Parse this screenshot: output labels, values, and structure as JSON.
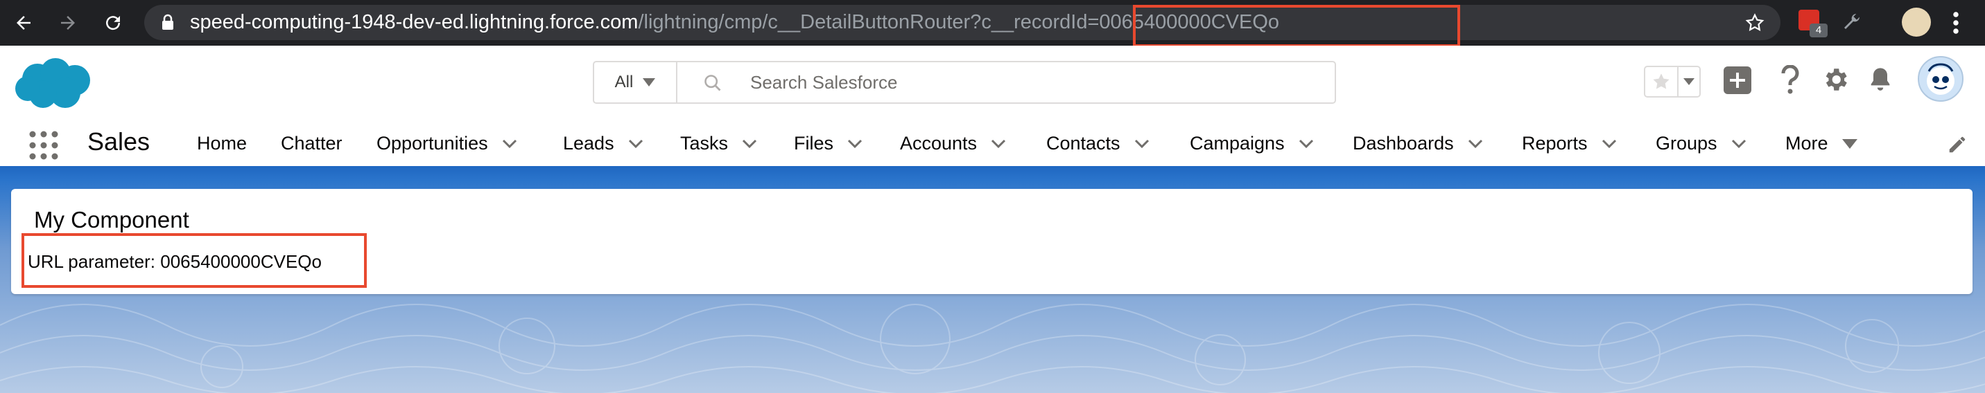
{
  "browser": {
    "url_host": "speed-computing-1948-dev-ed.lightning.force.com",
    "url_path": "/lightning/cmp/c__DetailButtonRouter",
    "url_query": "?c__recordId=0065400000CVEQo",
    "extension_badge_count": "4"
  },
  "header": {
    "search_scope": "All",
    "search_placeholder": "Search Salesforce"
  },
  "nav": {
    "app_name": "Sales",
    "items": [
      {
        "label": "Home"
      },
      {
        "label": "Chatter"
      },
      {
        "label": "Opportunities"
      },
      {
        "label": "Leads"
      },
      {
        "label": "Tasks"
      },
      {
        "label": "Files"
      },
      {
        "label": "Accounts"
      },
      {
        "label": "Contacts"
      },
      {
        "label": "Campaigns"
      },
      {
        "label": "Dashboards"
      },
      {
        "label": "Reports"
      },
      {
        "label": "Groups"
      },
      {
        "label": "More"
      }
    ]
  },
  "component": {
    "title": "My Component",
    "param_label": "URL parameter:",
    "param_value": "0065400000CVEQo"
  },
  "colors": {
    "highlight": "#e8492f",
    "brand_blue": "#1f67c1",
    "salesforce_cloud": "#1798c1"
  }
}
